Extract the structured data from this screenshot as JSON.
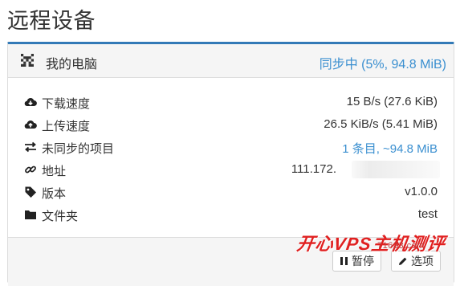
{
  "page": {
    "title": "远程设备"
  },
  "device": {
    "name": "我的电脑",
    "status": "同步中 (5%, 94.8 MiB)",
    "accent_color": "#3a8fd0",
    "rows": [
      {
        "icon": "cloud-download-icon",
        "label": "下载速度",
        "value": "15 B/s (27.6 KiB)"
      },
      {
        "icon": "cloud-upload-icon",
        "label": "上传速度",
        "value": "26.5 KiB/s (5.41 MiB)"
      },
      {
        "icon": "exchange-arrows-icon",
        "label": "未同步的项目",
        "value": "1 条目, ~94.8 MiB"
      },
      {
        "icon": "link-icon",
        "label": "地址",
        "value": "111.172."
      },
      {
        "icon": "tag-icon",
        "label": "版本",
        "value": "v1.0.0"
      },
      {
        "icon": "folder-icon",
        "label": "文件夹",
        "value": "test"
      }
    ]
  },
  "actions": {
    "pause_label": "暂停",
    "options_label": "选项"
  },
  "watermark": {
    "text": "开心VPS主机测评",
    "sub": "71633.com"
  }
}
